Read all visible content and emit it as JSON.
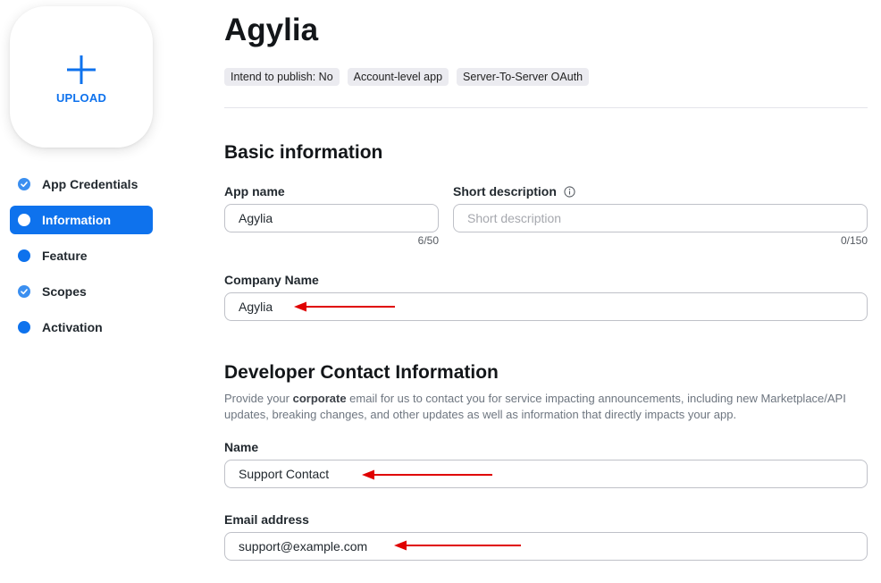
{
  "upload": {
    "label": "UPLOAD",
    "icon": "plus-icon"
  },
  "nav": {
    "items": [
      {
        "label": "App Credentials",
        "icon": "check-circle-icon"
      },
      {
        "label": "Information",
        "icon": "circle-icon",
        "active": true
      },
      {
        "label": "Feature",
        "icon": "dot-icon"
      },
      {
        "label": "Scopes",
        "icon": "check-circle-icon"
      },
      {
        "label": "Activation",
        "icon": "dot-icon"
      }
    ]
  },
  "app": {
    "title": "Agylia",
    "tags": [
      "Intend to publish: No",
      "Account-level app",
      "Server-To-Server OAuth"
    ]
  },
  "basic": {
    "title": "Basic information",
    "app_name": {
      "label": "App name",
      "value": "Agylia",
      "counter": "6/50"
    },
    "short_description": {
      "label": "Short description",
      "value": "",
      "placeholder": "Short description",
      "counter": "0/150"
    },
    "company_name": {
      "label": "Company Name",
      "value": "Agylia"
    }
  },
  "developer": {
    "title": "Developer Contact Information",
    "description_before": "Provide your ",
    "description_bold": "corporate",
    "description_after": " email for us to contact you for service impacting announcements, including new Marketplace/API updates, breaking changes, and other updates as well as information that directly impacts your app.",
    "name": {
      "label": "Name",
      "value": "Support Contact"
    },
    "email": {
      "label": "Email address",
      "value": "support@example.com"
    }
  },
  "colors": {
    "accent": "#0e72ed",
    "annotation_arrow": "#e00000"
  }
}
